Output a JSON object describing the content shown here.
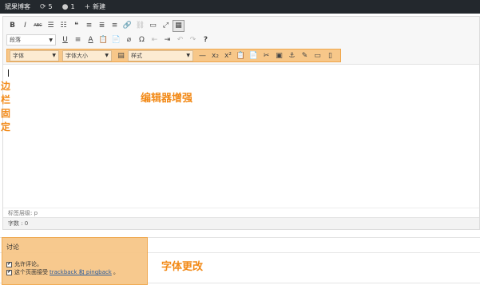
{
  "adminbar": {
    "site_name": "斌果博客",
    "updates_icon": "refresh-icon",
    "updates_count": "5",
    "comments_icon": "comment-icon",
    "comments_count": "1",
    "new_icon": "plus-icon",
    "new_label": "新建"
  },
  "toolbar": {
    "row1": [
      "B",
      "I",
      "ABC",
      "☰",
      "☷",
      "❝",
      "≡",
      "≣",
      "≡",
      "🔗",
      "⛓",
      "▭",
      "⤢",
      "▦"
    ],
    "format_select": "段落",
    "row2": [
      "U",
      "≡",
      "A",
      "📋",
      "📄",
      "⌀",
      "Ω",
      "⇤",
      "⇥",
      "↶",
      "↷",
      "?"
    ],
    "font_select": "字体",
    "size_select": "字体大小",
    "style_select": "样式",
    "row3": [
      "—",
      "x₂",
      "x²",
      "📋",
      "📄",
      "✂",
      "▣",
      "⚓",
      "✎",
      "▭",
      "▯"
    ]
  },
  "content": {
    "editor_callout": "编辑器增强",
    "side_callout": "边栏固定"
  },
  "status": {
    "path": "标签层级: p",
    "word_count": "字数 : 0"
  },
  "discussion": {
    "title": "讨论",
    "allow_comments": "允许评论。",
    "allow_trackbacks_prefix": "这个页面接受",
    "trackback_link": "trackback 和 pingback",
    "allow_trackbacks_suffix": "。",
    "font_callout": "字体更改"
  },
  "colors": {
    "highlight": "#f7c789",
    "callout_text": "#f28a18",
    "adminbar_bg": "#23282d"
  }
}
